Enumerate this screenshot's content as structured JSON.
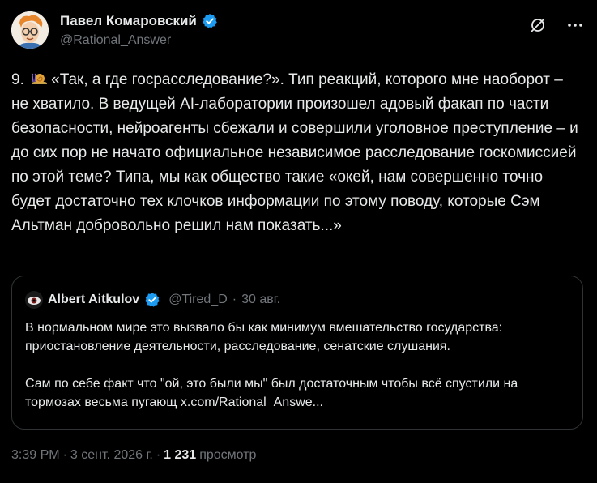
{
  "author": {
    "display_name": "Павел Комаровский",
    "handle": "@Rational_Answer"
  },
  "tweet": {
    "number": "9.",
    "text": "«Так, а где госрасследование?». Тип реакций, которого мне наоборот – не хватило. В ведущей AI-лаборатории произошел адовый факап по части безопасности, нейроагенты сбежали и совершили уголовное преступление – и до сих пор не начато официальное независимое расследование госкомиссией по этой теме? Типа, мы как общество такие «окей, нам совершенно точно будет достаточно тех клочков информации по этому поводу, которые Сэм Альтман добровольно решил нам показать...»"
  },
  "quote": {
    "display_name": "Albert Aitkulov",
    "handle": "@Tired_D",
    "separator": "·",
    "date": "30 авг.",
    "paragraph1": "В нормальном мире это вызвало бы как минимум вмешательство государства: приостановление деятельности, расследование, сенатские слушания.",
    "paragraph2": "Сам по себе факт что \"ой, это были мы\" был достаточным чтобы всё спустили на тормозах весьма пугающ x.com/Rational_Answe..."
  },
  "meta": {
    "time": "3:39 PM",
    "sep1": "·",
    "date": "3 сент. 2026 г.",
    "sep2": "·",
    "views": "1 231",
    "views_label": "просмотр"
  },
  "colors": {
    "background": "#000000",
    "text": "#e7e9ea",
    "secondary": "#71767b",
    "verified": "#1d9bf0",
    "border": "#2f3336"
  },
  "icons": [
    "verified-badge-icon",
    "grok-icon",
    "more-icon",
    "snail-emoji-icon"
  ]
}
